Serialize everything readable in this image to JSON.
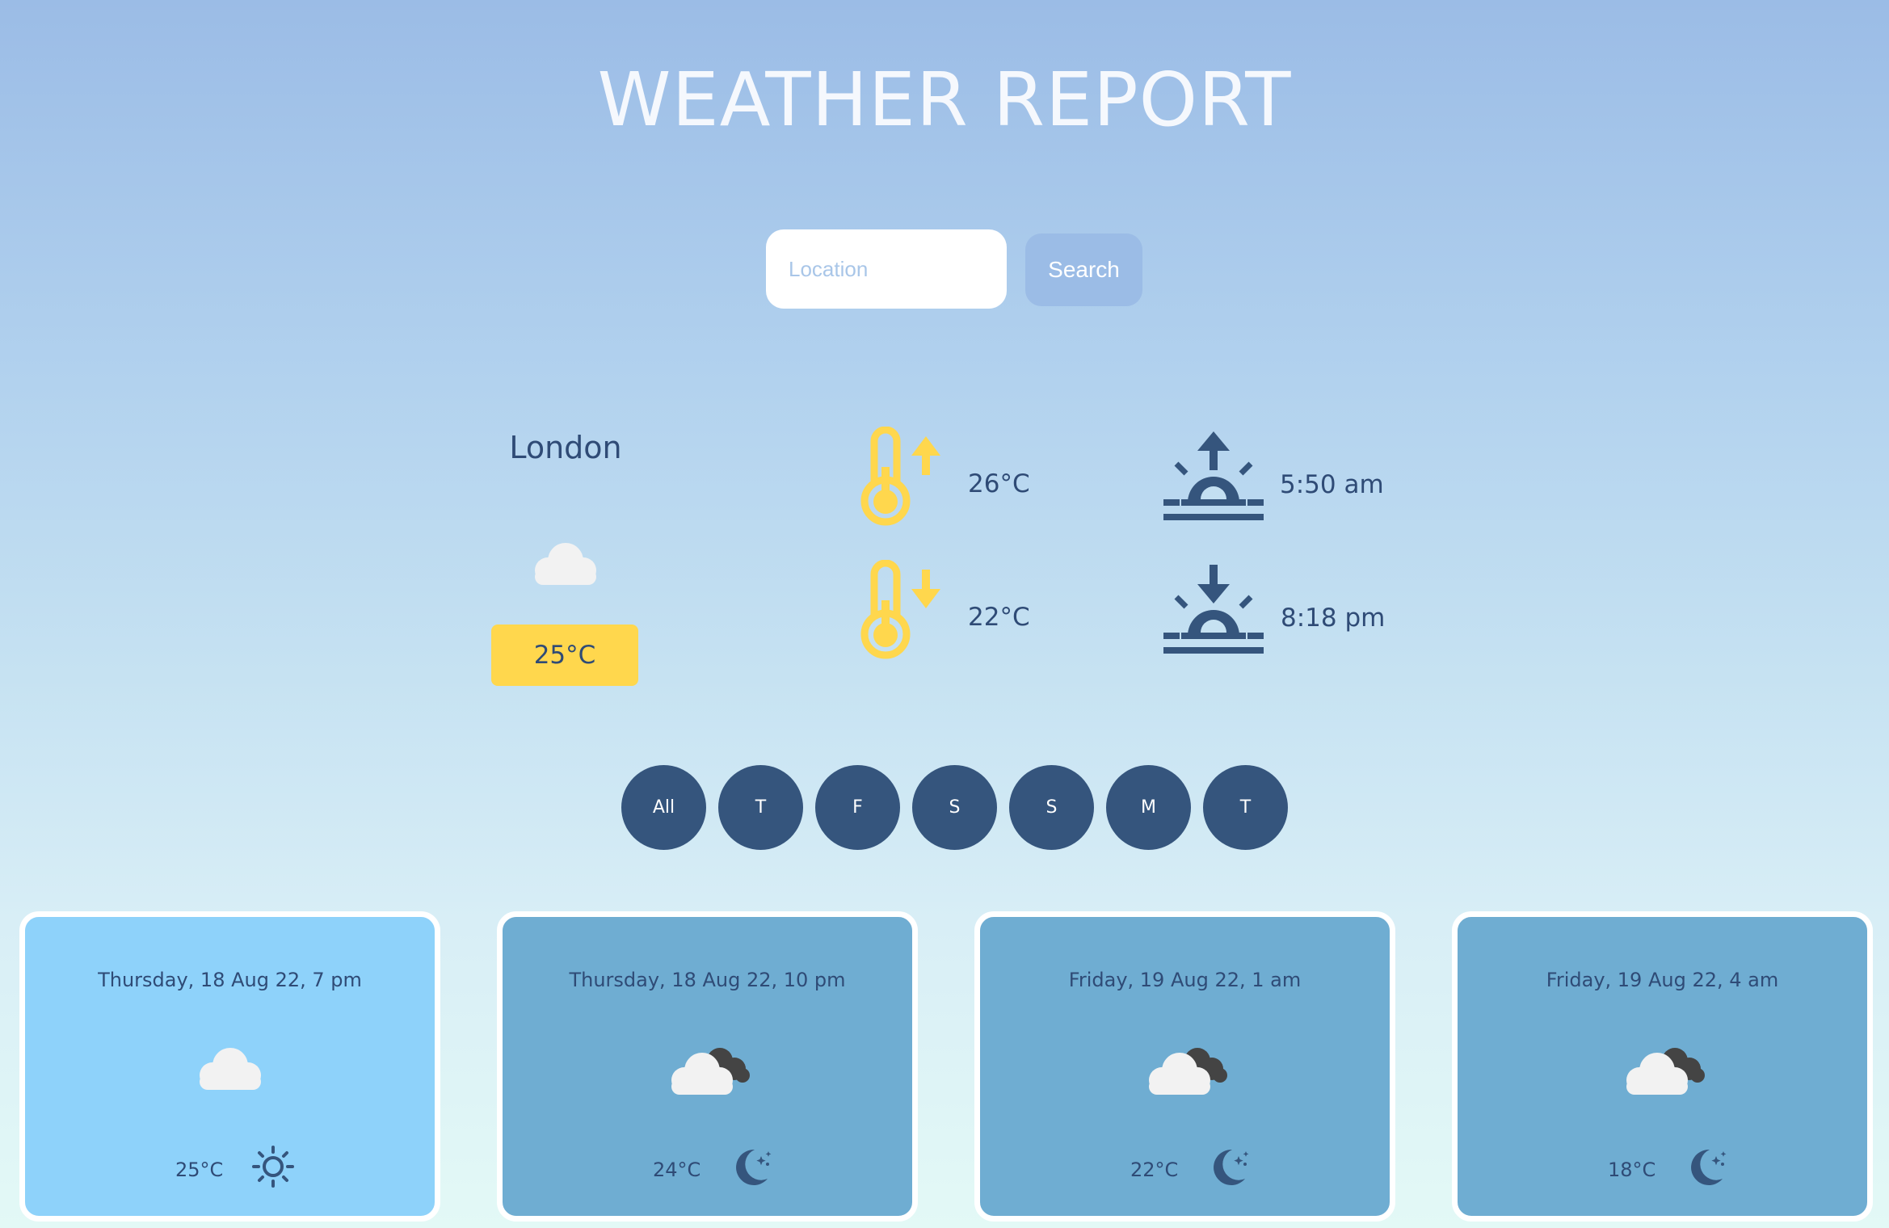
{
  "header": {
    "title": "WEATHER REPORT"
  },
  "search": {
    "placeholder": "Location",
    "button_label": "Search"
  },
  "current": {
    "city": "London",
    "condition_icon": "cloud-icon",
    "temperature": "25°C",
    "max_temperature": "26°C",
    "min_temperature": "22°C",
    "sunrise": "5:50 am",
    "sunset": "8:18 pm"
  },
  "day_filter": [
    "All",
    "T",
    "F",
    "S",
    "S",
    "M",
    "T"
  ],
  "forecast": [
    {
      "datetime": "Thursday, 18 Aug 22, 7 pm",
      "temperature": "25°C",
      "condition_icon": "cloud-icon",
      "period_icon": "sun-icon"
    },
    {
      "datetime": "Thursday, 18 Aug 22, 10 pm",
      "temperature": "24°C",
      "condition_icon": "night-cloud-icon",
      "period_icon": "moon-icon"
    },
    {
      "datetime": "Friday, 19 Aug 22, 1 am",
      "temperature": "22°C",
      "condition_icon": "night-cloud-icon",
      "period_icon": "moon-icon"
    },
    {
      "datetime": "Friday, 19 Aug 22, 4 am",
      "temperature": "18°C",
      "condition_icon": "night-cloud-icon",
      "period_icon": "moon-icon"
    }
  ],
  "colors": {
    "accent_yellow": "#ffd74d",
    "navy": "#35557d",
    "text": "#2f4b76",
    "card_day": "#8ed2fa",
    "card_night": "#6fadd2",
    "search_button": "#9bbce6"
  }
}
